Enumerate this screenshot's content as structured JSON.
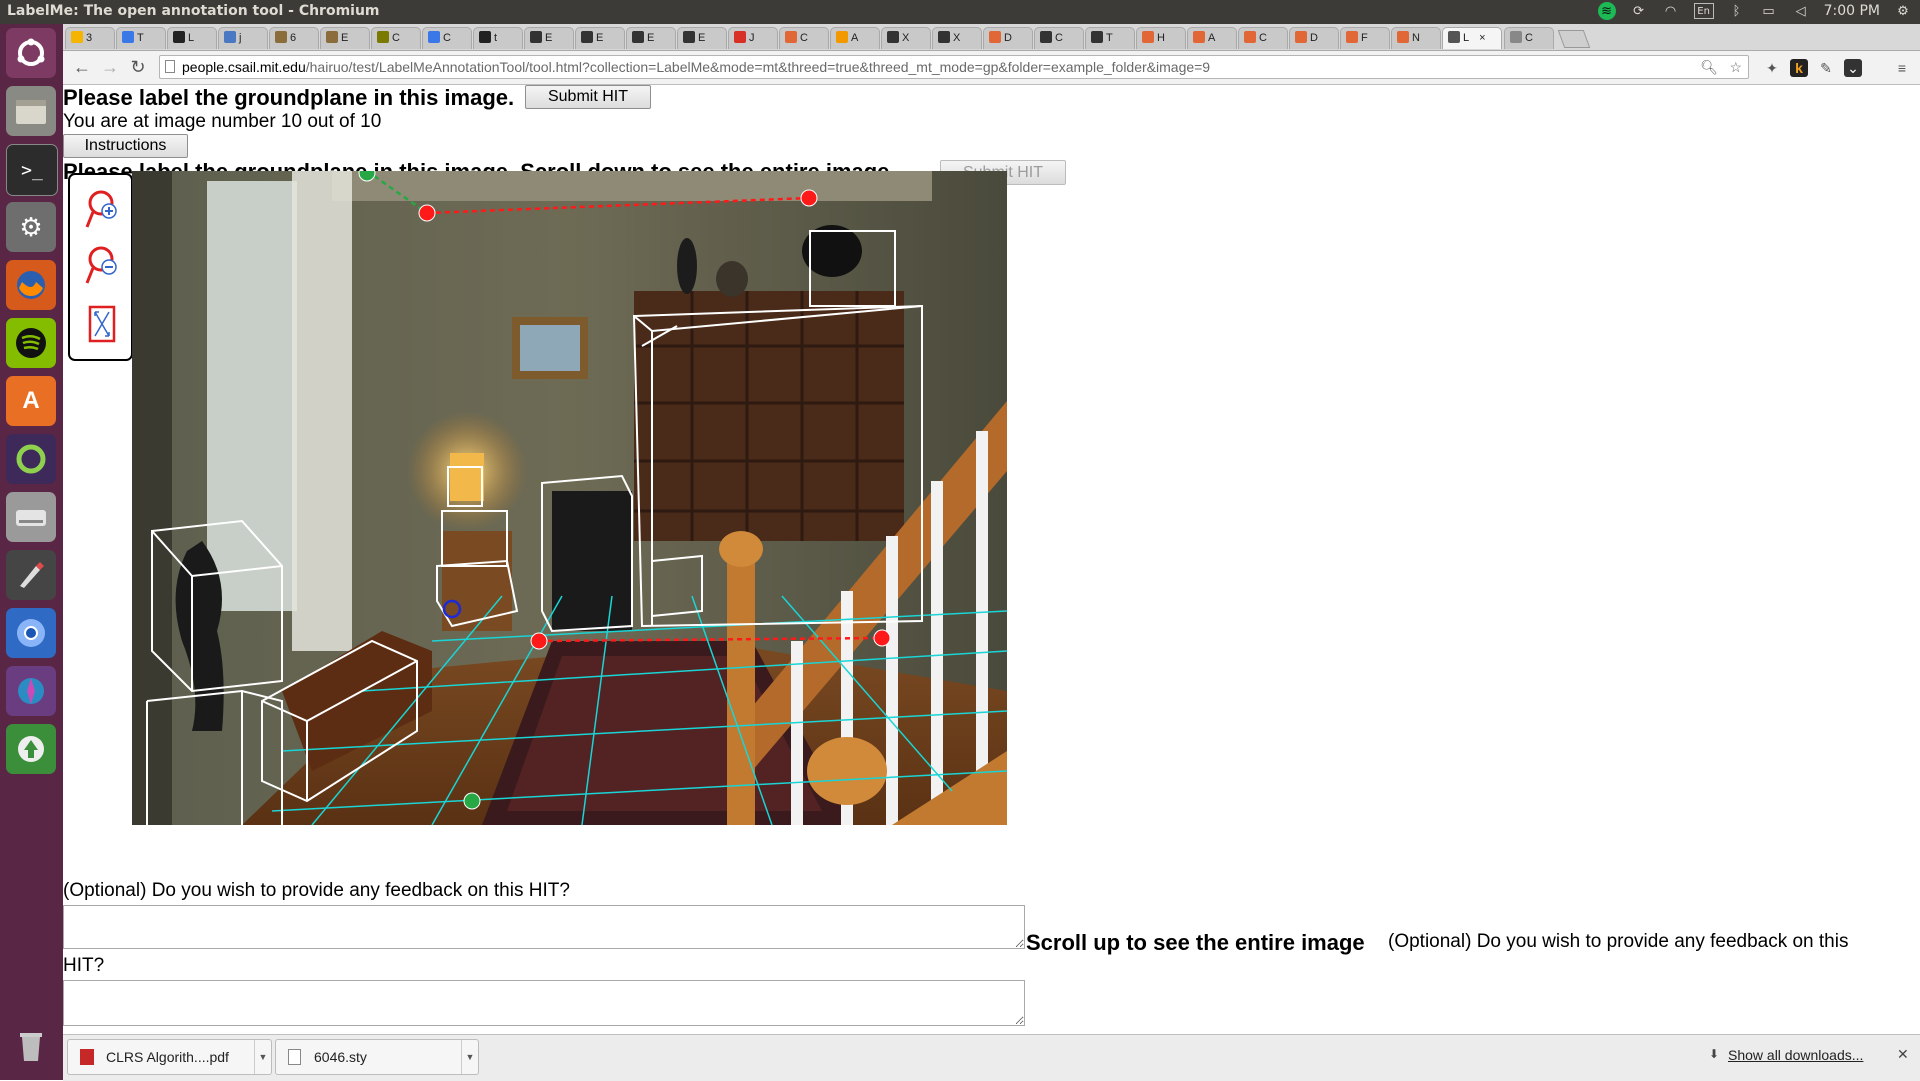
{
  "window": {
    "title": "LabelMe: The open annotation tool - Chromium"
  },
  "system_tray": {
    "language": "En",
    "time": "7:00 PM"
  },
  "tabs": [
    {
      "label": "3",
      "icon": "drive-icon",
      "color": "#f4b400"
    },
    {
      "label": "T",
      "icon": "doc-icon",
      "color": "#3b78e7"
    },
    {
      "label": "L",
      "icon": "github-icon",
      "color": "#222222"
    },
    {
      "label": "j",
      "icon": "shield-icon",
      "color": "#4a78c2"
    },
    {
      "label": "6",
      "icon": "puzzle-icon",
      "color": "#8a6d3b"
    },
    {
      "label": "E",
      "icon": "puzzle-icon",
      "color": "#8a6d3b"
    },
    {
      "label": "C",
      "icon": "coin-icon",
      "color": "#7a7a00"
    },
    {
      "label": "C",
      "icon": "doc-icon",
      "color": "#3b78e7"
    },
    {
      "label": "t",
      "icon": "github-icon",
      "color": "#222222"
    },
    {
      "label": "E",
      "icon": "wiki-icon",
      "color": "#333333"
    },
    {
      "label": "E",
      "icon": "wiki-icon",
      "color": "#333333"
    },
    {
      "label": "E",
      "icon": "wiki-icon",
      "color": "#333333"
    },
    {
      "label": "E",
      "icon": "wiki-icon",
      "color": "#333333"
    },
    {
      "label": "J",
      "icon": "gmail-icon",
      "color": "#d93025"
    },
    {
      "label": "C",
      "icon": "matlab-icon",
      "color": "#e16737"
    },
    {
      "label": "A",
      "icon": "orange-dot-icon",
      "color": "#f29900"
    },
    {
      "label": "X",
      "icon": "w3-icon",
      "color": "#333333"
    },
    {
      "label": "X",
      "icon": "w3-icon",
      "color": "#333333"
    },
    {
      "label": "D",
      "icon": "matlab-icon",
      "color": "#e16737"
    },
    {
      "label": "C",
      "icon": "wiki-icon",
      "color": "#333333"
    },
    {
      "label": "T",
      "icon": "wiki-icon",
      "color": "#333333"
    },
    {
      "label": "H",
      "icon": "matlab-icon",
      "color": "#e16737"
    },
    {
      "label": "A",
      "icon": "matlab-icon",
      "color": "#e16737"
    },
    {
      "label": "C",
      "icon": "matlab-icon",
      "color": "#e16737"
    },
    {
      "label": "D",
      "icon": "matlab-icon",
      "color": "#e16737"
    },
    {
      "label": "F",
      "icon": "matlab-icon",
      "color": "#e16737"
    },
    {
      "label": "N",
      "icon": "matlab-icon",
      "color": "#e16737"
    },
    {
      "label": "L",
      "icon": "labelme-icon",
      "color": "#555555",
      "active": true
    },
    {
      "label": "C",
      "icon": "gear-icon",
      "color": "#888888"
    }
  ],
  "address": {
    "host": "people.csail.mit.edu",
    "path": "/hairuo/test/LabelMeAnnotationTool/tool.html?collection=LabelMe&mode=mt&threed=true&threed_mt_mode=gp&folder=example_folder&image=9"
  },
  "page": {
    "heading": "Please label the groundplane in this image.",
    "submit_label": "Submit HIT",
    "progress_text": "You are at image number 10 out of 10",
    "instructions_label": "Instructions",
    "heading2": "Please label the groundplane in this image. Scroll down to see the entire image.",
    "submit2_label": "Submit HIT",
    "feedback_prompt": "(Optional) Do you wish to provide any feedback on this HIT?",
    "scroll_up_text": "Scroll up to see the entire image",
    "feedback_prompt2": "(Optional) Do you wish to provide any feedback on this HIT?",
    "feedback_value": "",
    "feedback2_value": ""
  },
  "downloads": {
    "items": [
      {
        "name": "CLRS Algorith....pdf",
        "icon": "pdf-icon"
      },
      {
        "name": "6046.sty",
        "icon": "file-icon"
      }
    ],
    "show_all": "Show all downloads..."
  },
  "colors": {
    "annotation_red": "#ff1a1a",
    "box_white": "#ffffff",
    "grid_cyan": "#19d5d5",
    "green_point": "#27a844",
    "blue_point": "#1c2bd6"
  }
}
